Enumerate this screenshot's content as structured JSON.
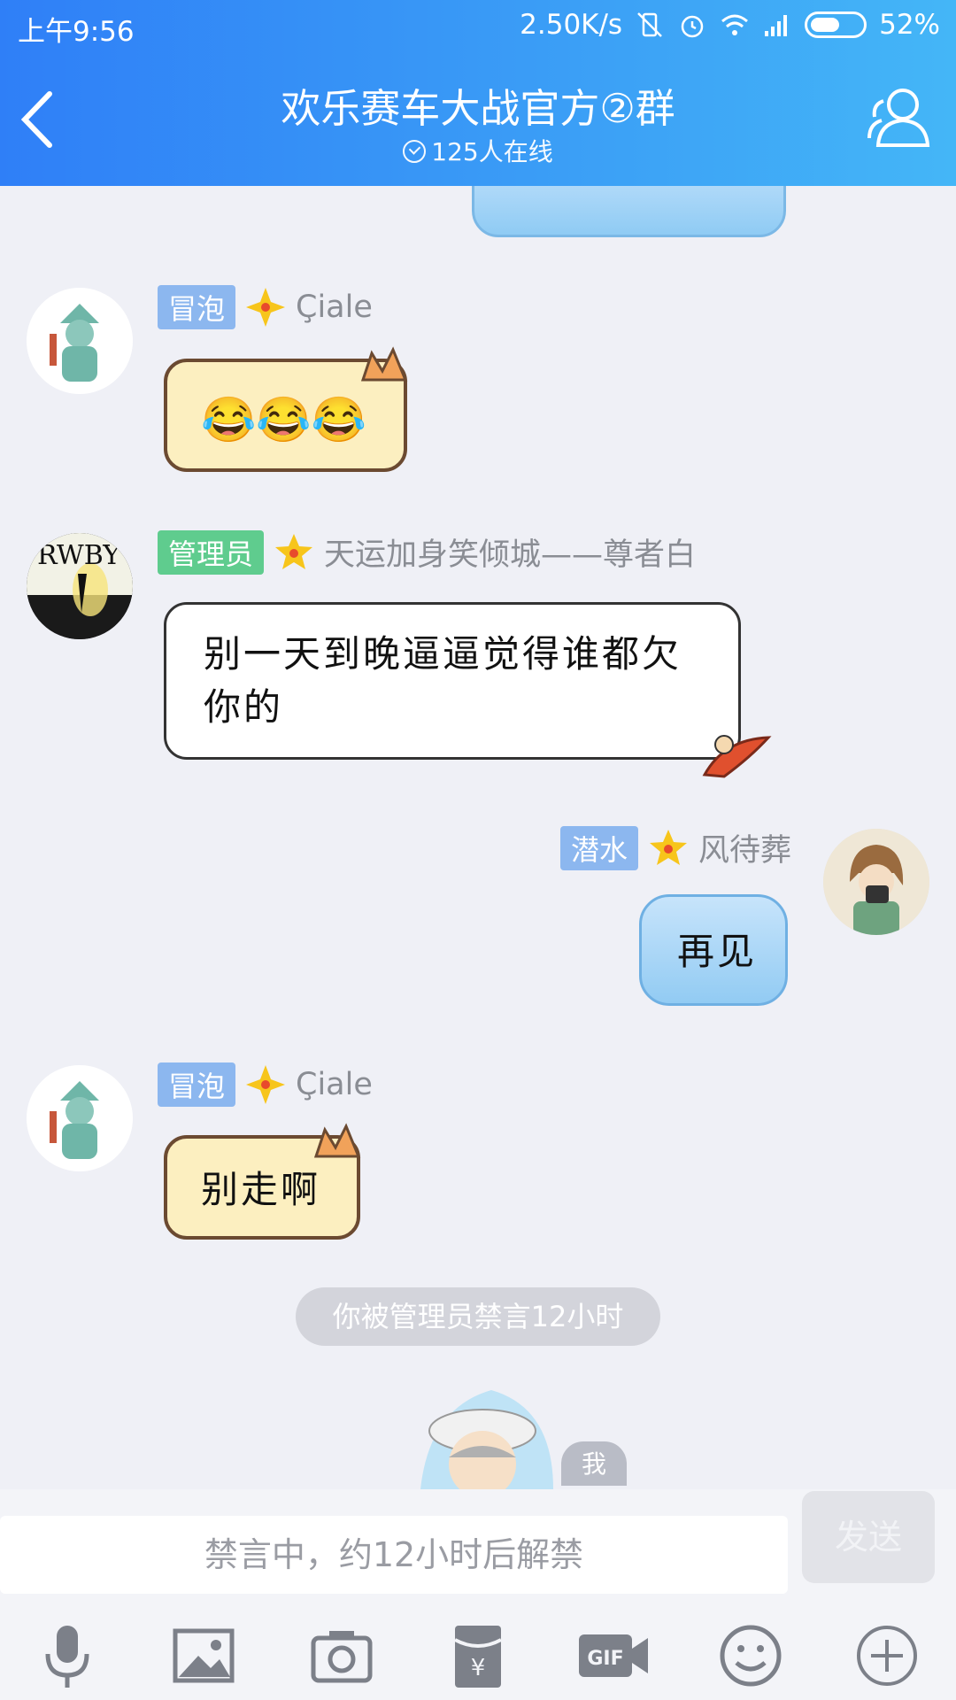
{
  "status_bar": {
    "time": "上午9:56",
    "speed": "2.50K/s",
    "battery": "52%"
  },
  "header": {
    "title": "欢乐赛车大战官方②群",
    "online": "125人在线"
  },
  "messages": [
    {
      "badge": "冒泡",
      "name": "Çiale",
      "emojis": [
        "😂",
        "😂",
        "😂"
      ]
    },
    {
      "badge": "管理员",
      "name": "天运加身笑倾城——尊者白",
      "text": "别一天到晚逼逼觉得谁都欠你的"
    },
    {
      "badge": "潜水",
      "name": "风待葬",
      "text": "再见"
    },
    {
      "badge": "冒泡",
      "name": "Çiale",
      "text": "别走啊"
    }
  ],
  "avatars": {
    "rwby_text": "RWBY"
  },
  "notice": "你被管理员禁言12小时",
  "me_label": "我",
  "input": {
    "placeholder": "禁言中，约12小时后解禁",
    "send_label": "发送"
  },
  "toolbar": [
    "microphone-icon",
    "image-icon",
    "camera-icon",
    "red-packet-icon",
    "gif-icon",
    "emoji-icon",
    "plus-icon"
  ],
  "colors": {
    "header_start": "#2f7ff7",
    "header_end": "#44b6f7",
    "chat_bg": "#eff0f6",
    "badge_blue": "#8cb7ef",
    "badge_green": "#5fcc8e"
  }
}
